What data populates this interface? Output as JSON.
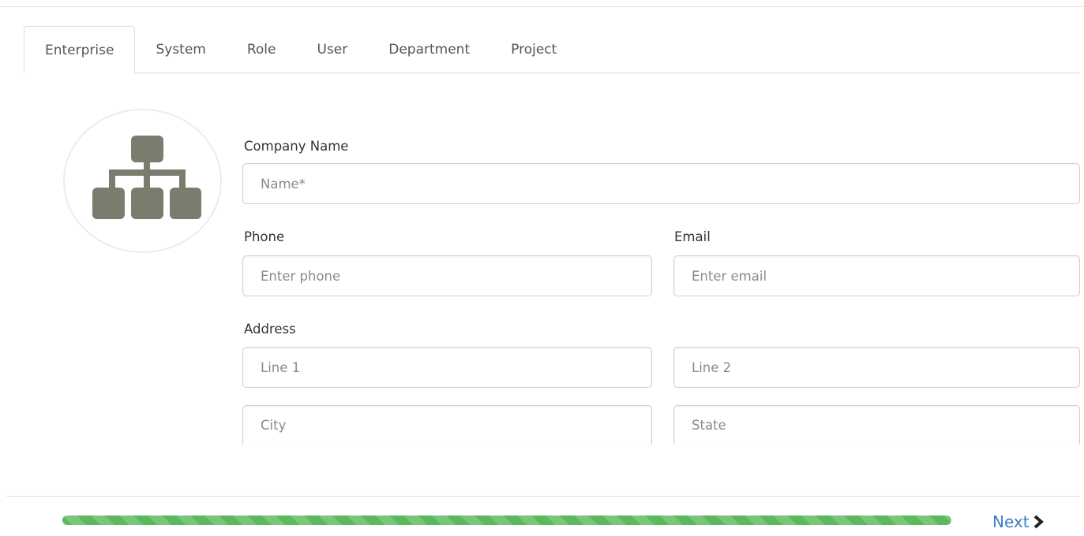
{
  "tabs": [
    {
      "label": "Enterprise",
      "active": true
    },
    {
      "label": "System",
      "active": false
    },
    {
      "label": "Role",
      "active": false
    },
    {
      "label": "User",
      "active": false
    },
    {
      "label": "Department",
      "active": false
    },
    {
      "label": "Project",
      "active": false
    }
  ],
  "logo": {
    "icon": "sitemap-icon",
    "color": "#7c7c6e"
  },
  "form": {
    "company_name": {
      "label": "Company Name",
      "placeholder": "Name*",
      "value": ""
    },
    "phone": {
      "label": "Phone",
      "placeholder": "Enter phone",
      "value": ""
    },
    "email": {
      "label": "Email",
      "placeholder": "Enter email",
      "value": ""
    },
    "address": {
      "label": "Address",
      "line1": {
        "placeholder": "Line 1",
        "value": ""
      },
      "line2": {
        "placeholder": "Line 2",
        "value": ""
      },
      "city": {
        "placeholder": "City",
        "value": ""
      },
      "state": {
        "placeholder": "State",
        "value": ""
      }
    }
  },
  "progress": {
    "percent": 100,
    "color": "#5cb85c"
  },
  "footer": {
    "next_label": "Next",
    "next_icon": "chevron-right-icon",
    "link_color": "#3a7fc1"
  }
}
